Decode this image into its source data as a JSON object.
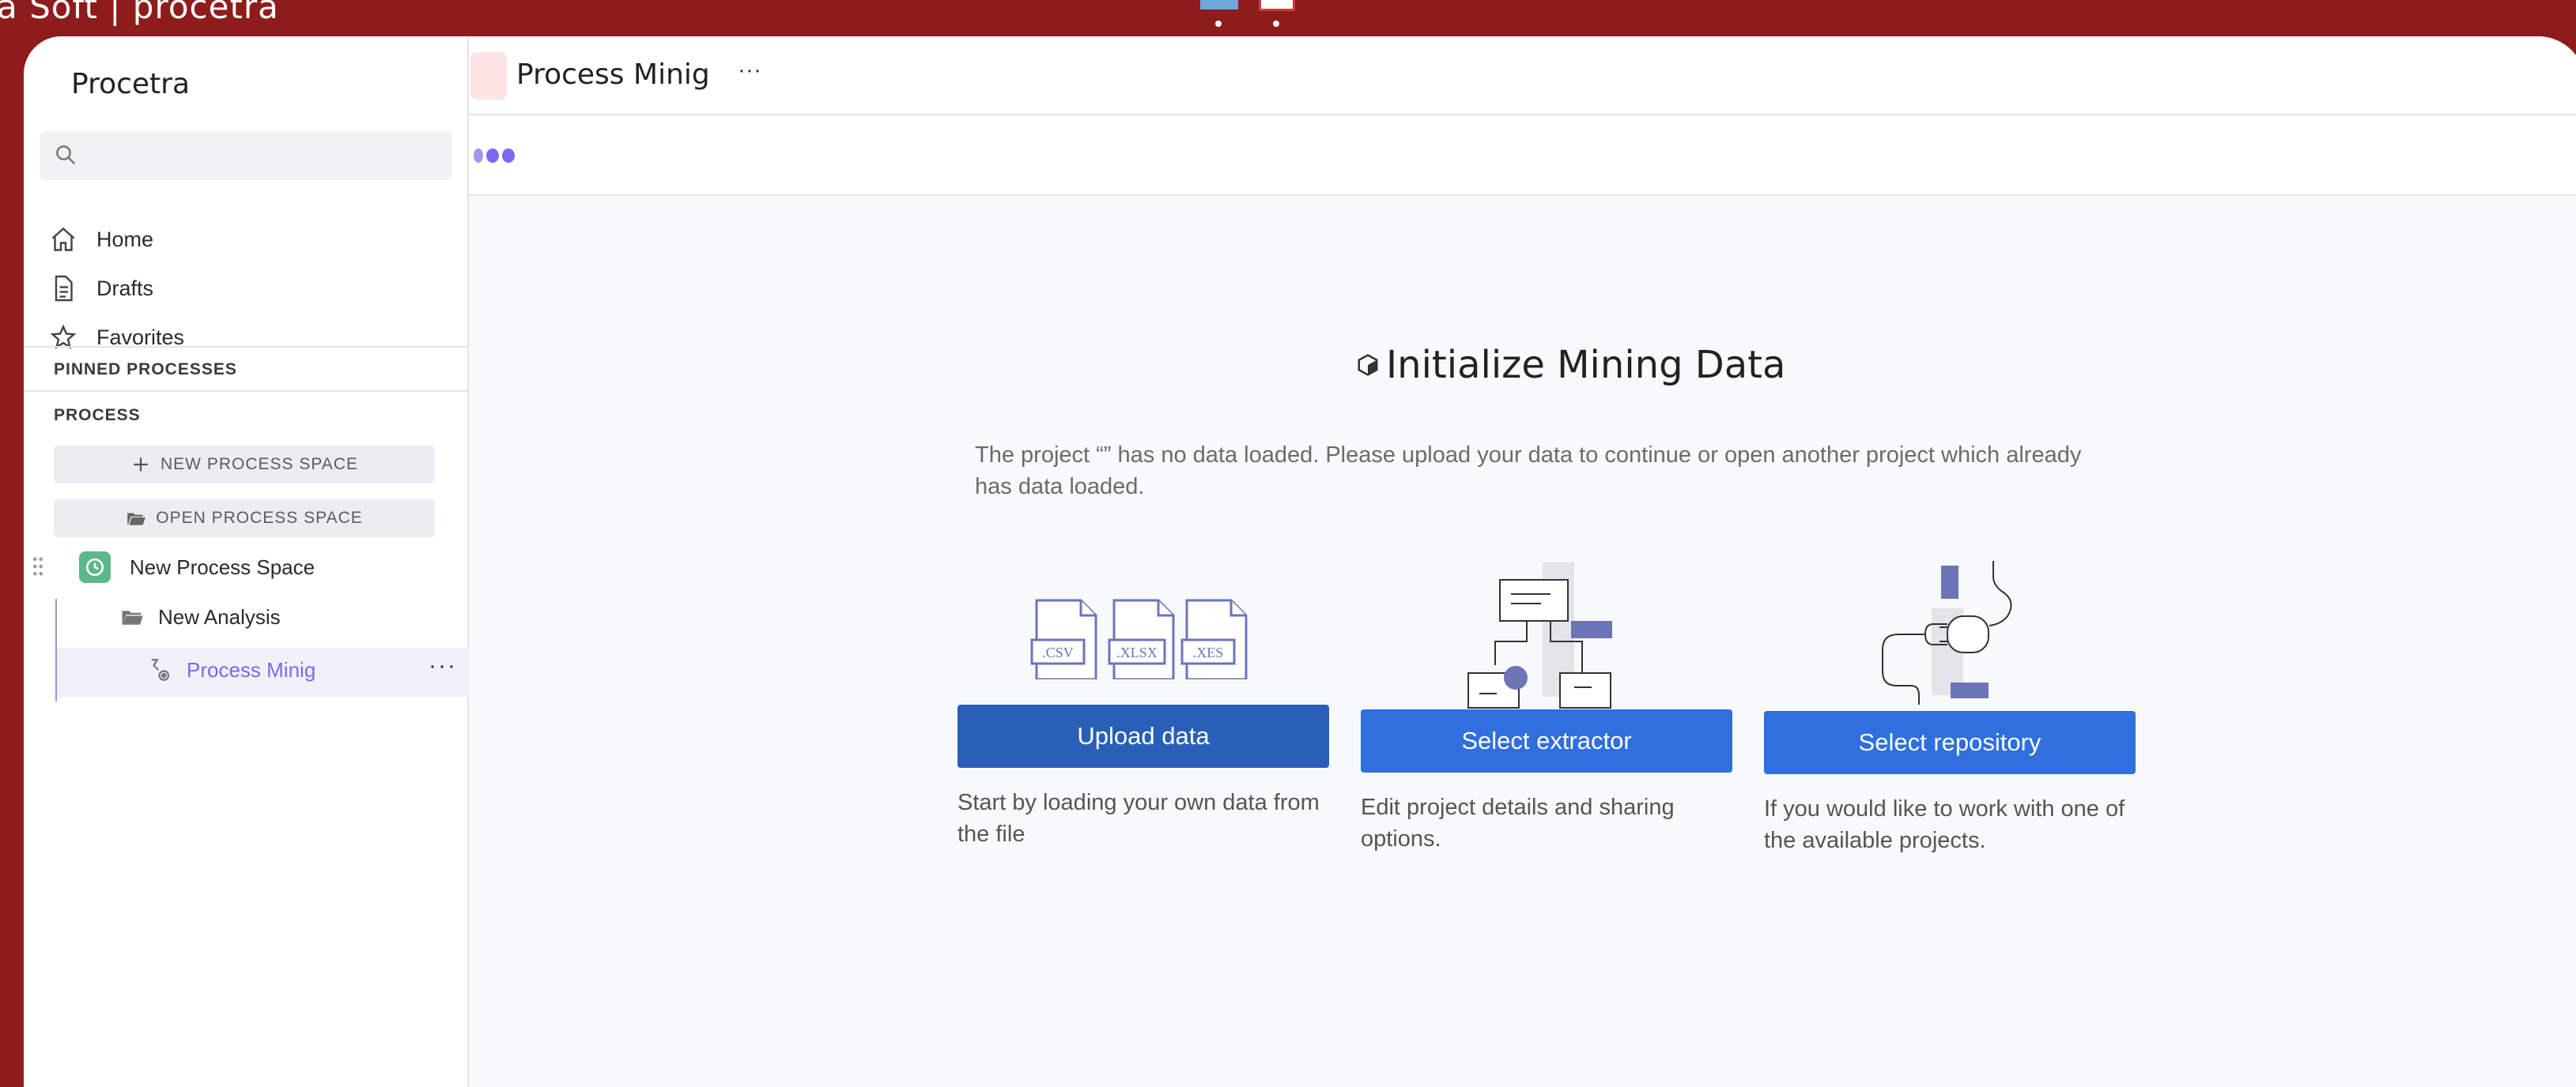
{
  "window": {
    "title": "a Soft | procetra"
  },
  "sidebar": {
    "brand": "Procetra",
    "search_placeholder": "",
    "nav": [
      {
        "label": "Home",
        "icon": "home-icon"
      },
      {
        "label": "Drafts",
        "icon": "document-icon"
      },
      {
        "label": "Favorites",
        "icon": "star-icon"
      }
    ],
    "pinned_label": "PINNED PROCESSES",
    "process_label": "PROCESS",
    "new_space_label": "NEW PROCESS SPACE",
    "open_space_label": "OPEN PROCESS SPACE",
    "tree": {
      "space": "New Process Space",
      "analysis": "New Analysis",
      "process": "Process Minig"
    }
  },
  "header": {
    "title": "Process Minig",
    "more": "···"
  },
  "main": {
    "title": "Initialize Mining Data",
    "description": "The project “” has no data loaded. Please upload your data to continue or open another project which already has data loaded.",
    "file_types": [
      ".CSV",
      ".XLSX",
      ".XES"
    ],
    "cards": {
      "upload": {
        "button": "Upload data",
        "caption": "Start by loading your own data from the file"
      },
      "extractor": {
        "button": "Select extractor",
        "caption": "Edit project details and sharing options."
      },
      "repository": {
        "button": "Select repository",
        "caption": "If you would like to work with one of the available projects."
      }
    }
  },
  "colors": {
    "accent": "#2f6fde",
    "brand_bg": "#8e1c1a",
    "active_text": "#7b68ee",
    "illustration": "#6c75b8"
  }
}
